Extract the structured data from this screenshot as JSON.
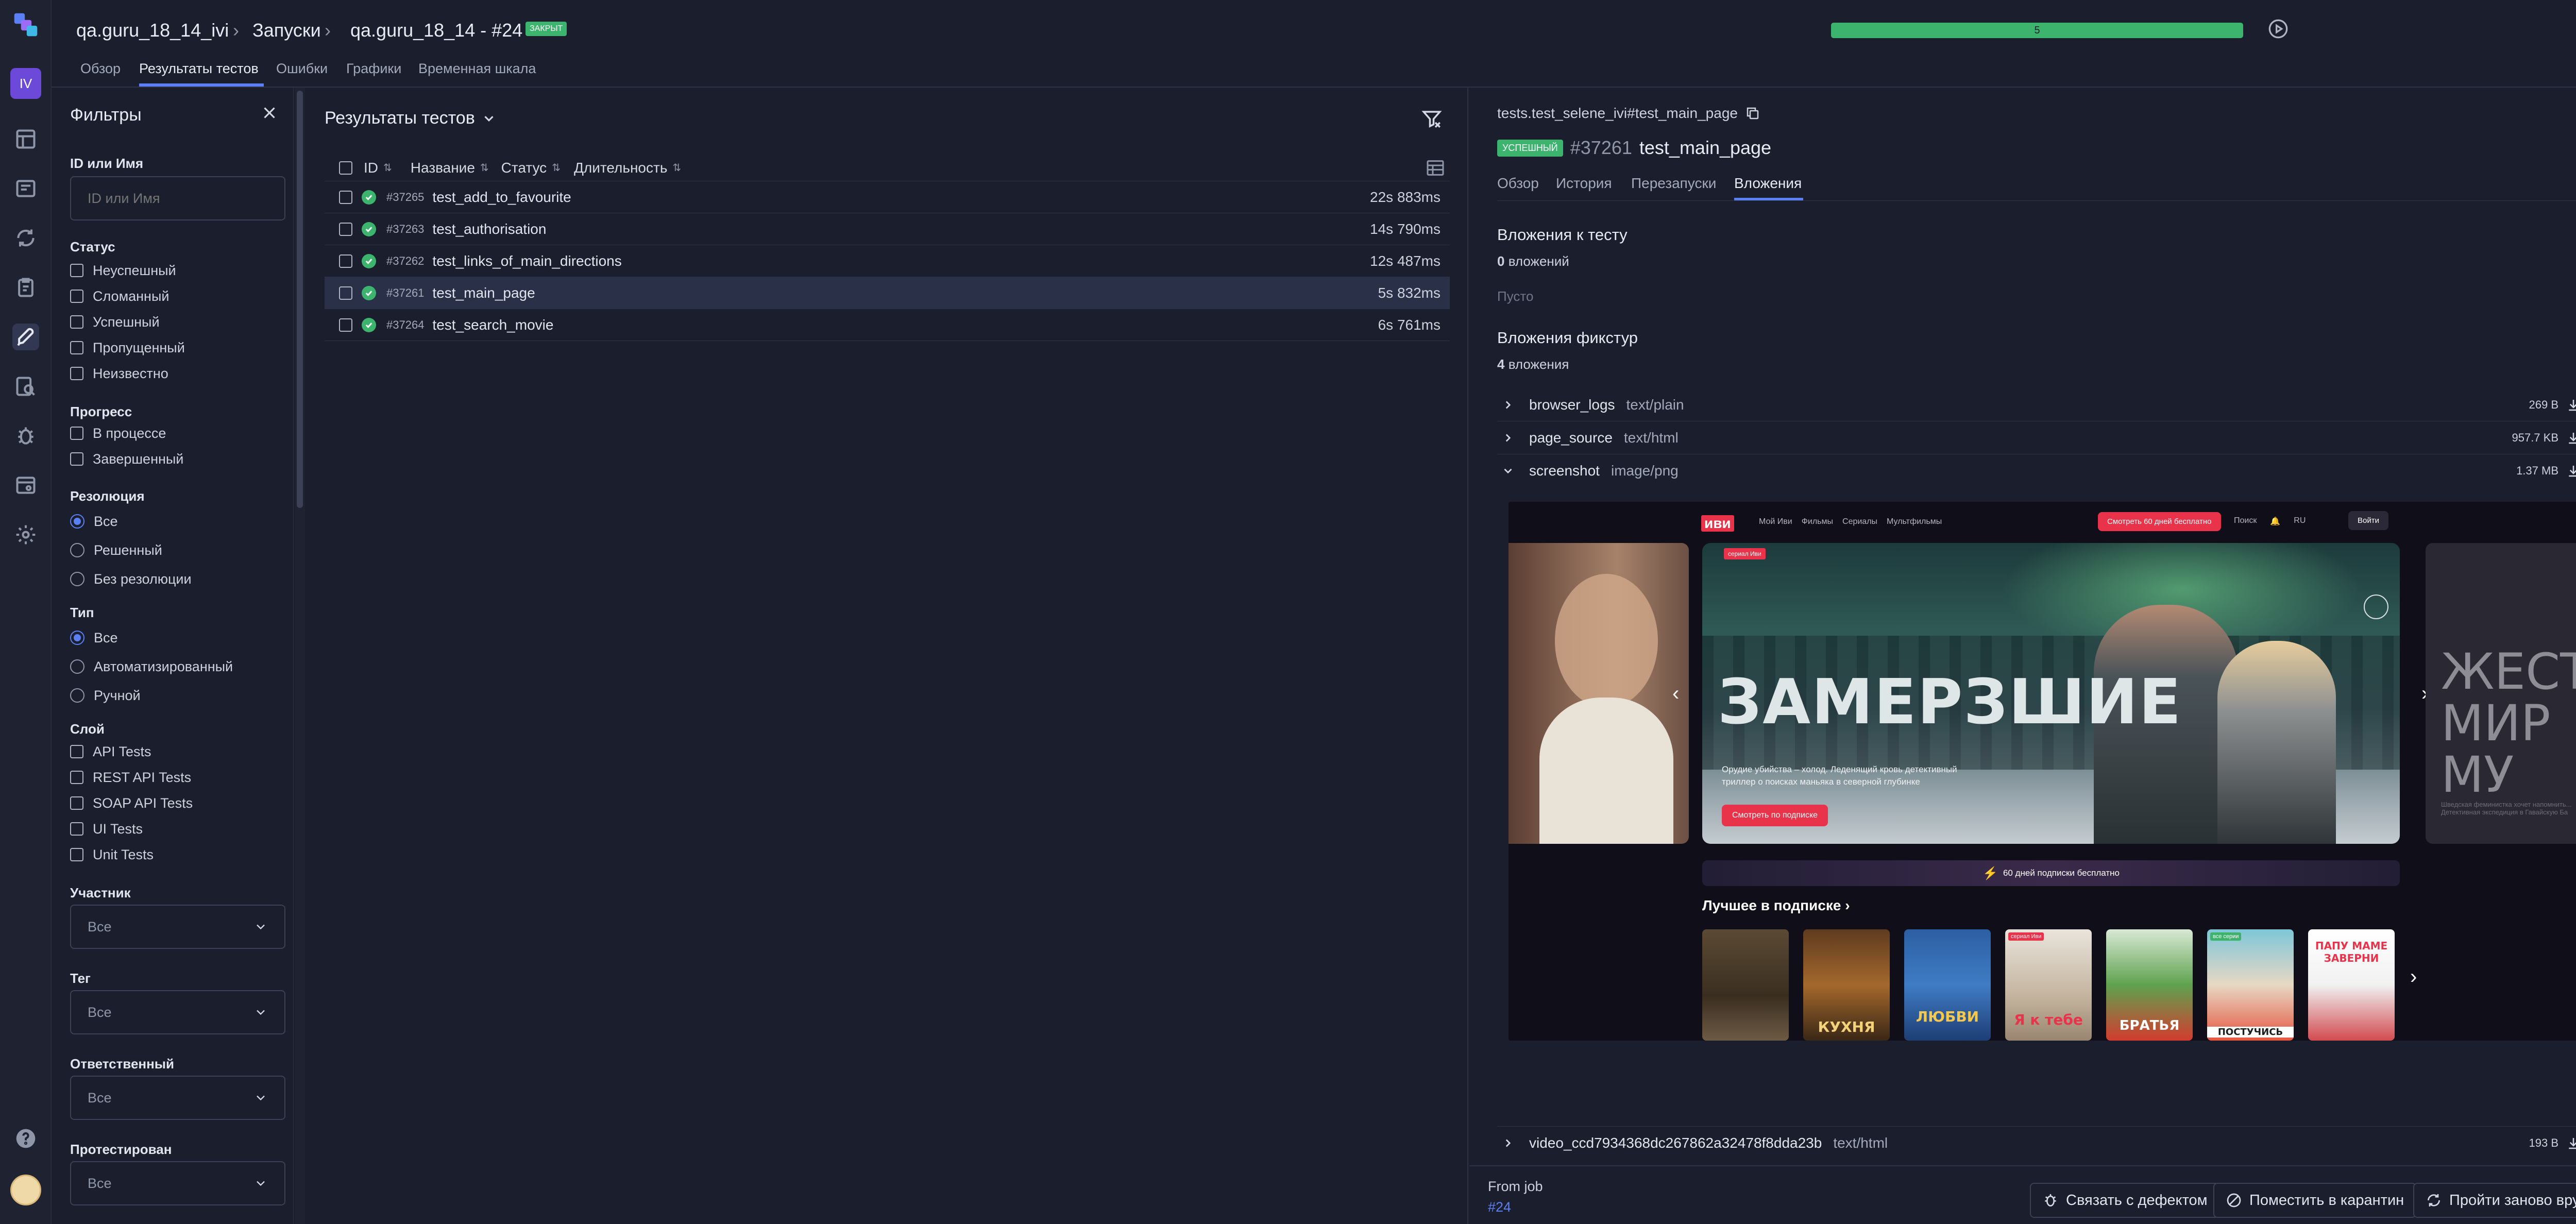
{
  "app": {
    "user_initials": "IV"
  },
  "header": {
    "breadcrumb": [
      "qa.guru_18_14_ivi",
      "Запуски",
      "qa.guru_18_14 - #24"
    ],
    "closed_badge": "ЗАКРЫТ",
    "progress_label": "5",
    "progress_fraction": 1.0,
    "tabs": [
      "Обзор",
      "Результаты тестов",
      "Ошибки",
      "Графики",
      "Временная шкала"
    ],
    "active_tab": "Результаты тестов"
  },
  "filters": {
    "title": "Фильтры",
    "id_name_label": "ID или Имя",
    "id_name_placeholder": "ID или Имя",
    "status_label": "Статус",
    "status_options": [
      "Неуспешный",
      "Сломанный",
      "Успешный",
      "Пропущенный",
      "Неизвестно"
    ],
    "progress_label": "Прогресс",
    "progress_options": [
      "В процессе",
      "Завершенный"
    ],
    "resolution_label": "Резолюция",
    "resolution_options": [
      "Все",
      "Решенный",
      "Без резолюции"
    ],
    "type_label": "Тип",
    "type_options": [
      "Все",
      "Автоматизированный",
      "Ручной"
    ],
    "layer_label": "Слой",
    "layer_options": [
      "API Tests",
      "REST API Tests",
      "SOAP API Tests",
      "UI Tests",
      "Unit Tests"
    ],
    "member_label": "Участник",
    "member_value": "Все",
    "tag_label": "Тег",
    "tag_value": "Все",
    "owner_label": "Ответственный",
    "owner_value": "Все",
    "tested_label": "Протестирован",
    "tested_value": "Все"
  },
  "results": {
    "title": "Результаты тестов",
    "columns": {
      "id": "ID",
      "name": "Название",
      "status": "Статус",
      "duration": "Длительность"
    },
    "rows": [
      {
        "id": "#37265",
        "name": "test_add_to_favourite",
        "duration": "22s 883ms",
        "status": "passed"
      },
      {
        "id": "#37263",
        "name": "test_authorisation",
        "duration": "14s 790ms",
        "status": "passed"
      },
      {
        "id": "#37262",
        "name": "test_links_of_main_directions",
        "duration": "12s 487ms",
        "status": "passed"
      },
      {
        "id": "#37261",
        "name": "test_main_page",
        "duration": "5s 832ms",
        "status": "passed"
      },
      {
        "id": "#37264",
        "name": "test_search_movie",
        "duration": "6s 761ms",
        "status": "passed"
      }
    ]
  },
  "detail": {
    "path": "tests.test_selene_ivi#test_main_page",
    "status_badge": "УСПЕШНЫЙ",
    "id": "#37261",
    "name": "test_main_page",
    "tabs": [
      "Обзор",
      "История",
      "Перезапуски",
      "Вложения"
    ],
    "active_tab": "Вложения",
    "test_attachments_title": "Вложения к тесту",
    "test_attachments_count_num": "0",
    "test_attachments_count_word": "вложений",
    "empty_label": "Пусто",
    "fixture_attachments_title": "Вложения фикстур",
    "fixture_attachments_count_num": "4",
    "fixture_attachments_count_word": "вложения",
    "attachments": [
      {
        "name": "browser_logs",
        "type": "text/plain",
        "size": "269 B"
      },
      {
        "name": "page_source",
        "type": "text/html",
        "size": "957.7 KB"
      },
      {
        "name": "screenshot",
        "type": "image/png",
        "size": "1.37 MB"
      },
      {
        "name": "video_ccd7934368dc267862a32478f8dda23b",
        "type": "text/html",
        "size": "193 B"
      }
    ],
    "footer": {
      "from_job_label": "From job",
      "job_link": "#24",
      "link_defect_button": "Связать с дефектом",
      "quarantine_button": "Поместить в карантин",
      "rerun_button": "Пройти заново вручную"
    }
  },
  "screenshot": {
    "logo": "иви",
    "nav": [
      "Мой Иви",
      "Фильмы",
      "Сериалы",
      "Мультфильмы"
    ],
    "cta": "Смотреть 60 дней бесплатно",
    "search": "Поиск",
    "lang": "RU",
    "login": "Войти",
    "badge": "сериал Иви",
    "hero_title": "ЗАМЕРЗШИЕ",
    "hero_desc": "Орудие убийства – холод. Леденящий кровь детективный триллер о поисках маньяка в северной глубинке",
    "hero_button": "Смотреть по подписке",
    "side_text": "ЖЕСТО МИР МУ",
    "side_desc": "Шведская феминистка хочет напомнить... Детективная экспедиция в Гавайскую Ба",
    "promo": "60 дней подписки бесплатно",
    "section_title": "Лучшее в подписке",
    "poster_texts": [
      "",
      "КУХНЯ",
      "ЛЮБВИ",
      "Я к тебе",
      "БРАТЬЯ",
      "ПОСТУЧИСЬ",
      "ПАПУ МАМЕ ЗАВЕРНИ"
    ],
    "poster_badges": [
      "",
      "",
      "",
      "сериал Иви",
      "",
      "все серии",
      ""
    ]
  },
  "colors": {
    "accent": "#5b7ff5",
    "success": "#3db46d",
    "brand_red": "#e8334a",
    "background": "#1b1e2c"
  }
}
